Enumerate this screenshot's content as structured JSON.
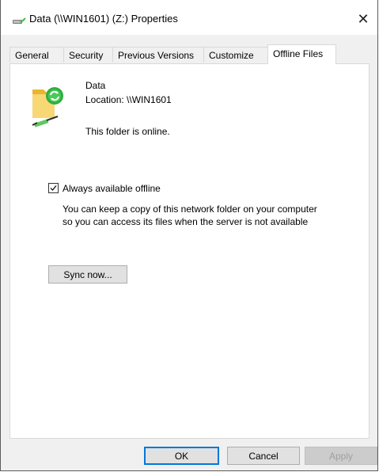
{
  "window": {
    "title": "Data (\\\\WIN1601) (Z:) Properties",
    "close_label": "✕"
  },
  "tabs": [
    {
      "label": "General"
    },
    {
      "label": "Security"
    },
    {
      "label": "Previous Versions"
    },
    {
      "label": "Customize"
    },
    {
      "label": "Offline Files",
      "selected": true
    }
  ],
  "folder": {
    "name": "Data",
    "location": "Location:  \\\\WIN1601",
    "status": "This folder is online."
  },
  "offline": {
    "checkbox_label": "Always available offline",
    "checked": true,
    "description_line1": "You can keep a copy of this network folder on your computer",
    "description_line2": "so you can access its files when the server is not available"
  },
  "buttons": {
    "sync": "Sync now...",
    "ok": "OK",
    "cancel": "Cancel",
    "apply": "Apply"
  },
  "colors": {
    "accent": "#0078d7",
    "folder_yellow": "#f5c242",
    "sync_green": "#2eae3f"
  }
}
